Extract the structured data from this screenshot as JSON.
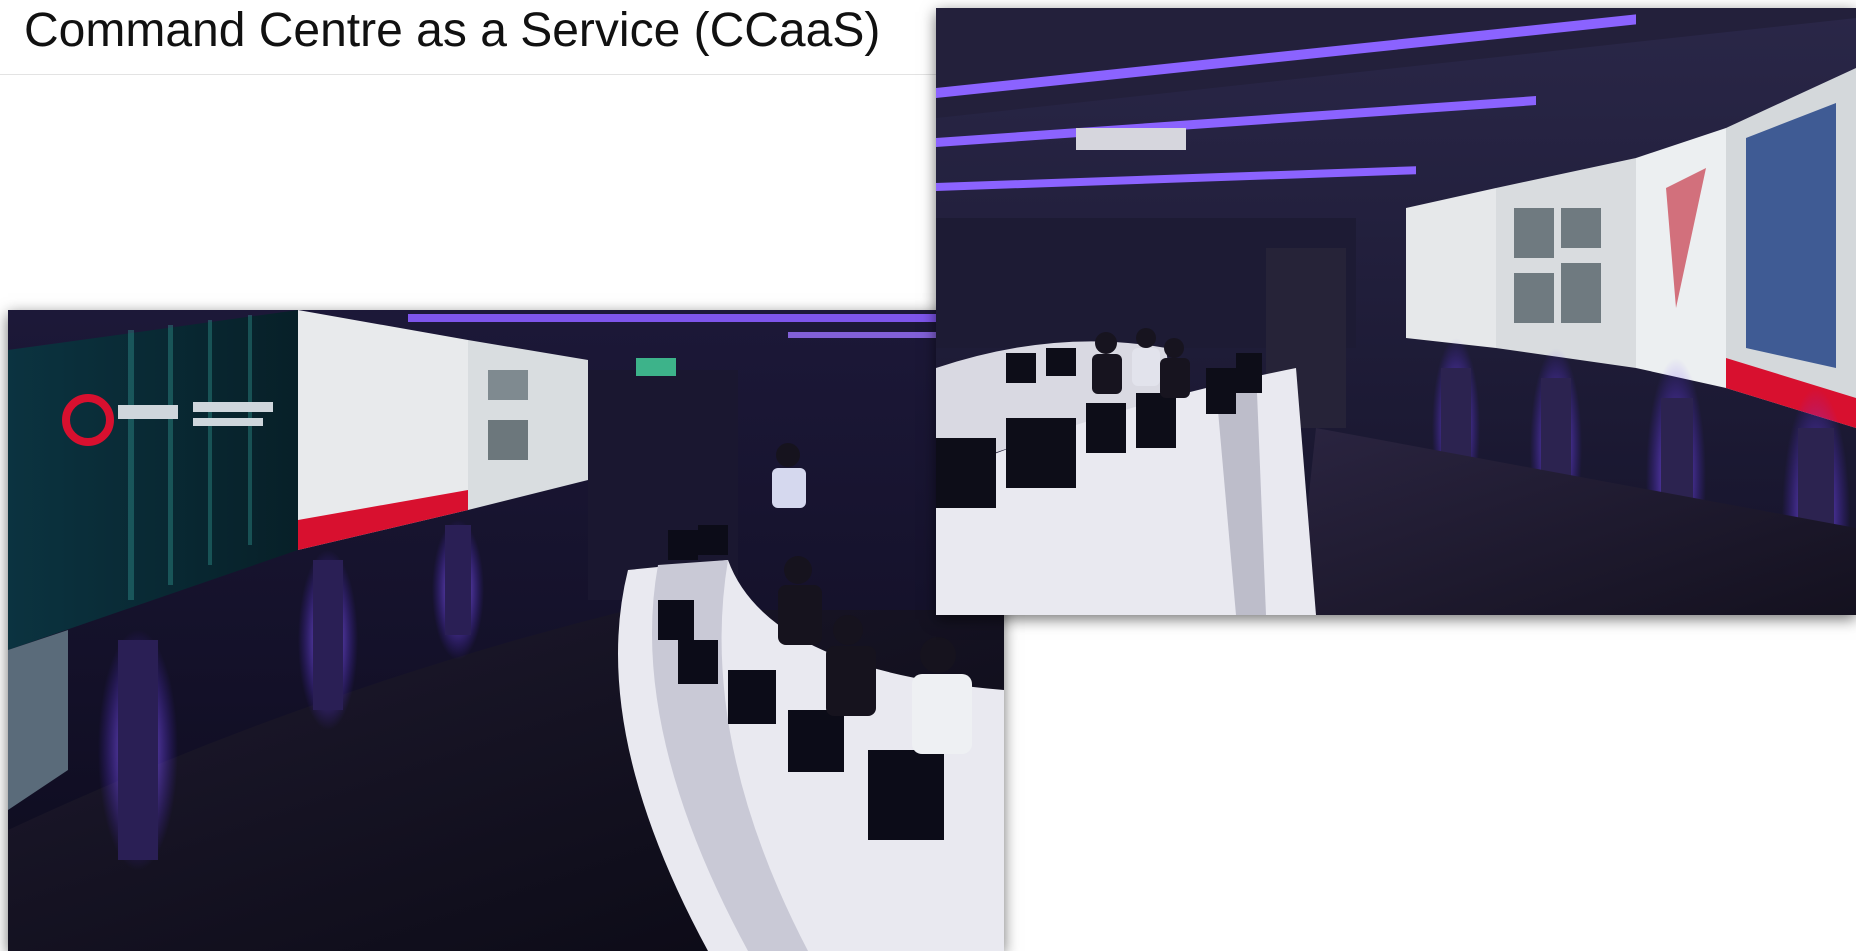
{
  "slide": {
    "title": "Command Centre as a Service (CCaaS)"
  },
  "photos": [
    {
      "name": "control-room-photo-left"
    },
    {
      "name": "control-room-photo-right"
    }
  ],
  "colors": {
    "background": "#ffffff",
    "title_text": "#111111",
    "room_dark": "#14122b",
    "neon_violet": "#7a4dff",
    "console_white": "#e9e9f0",
    "accent_red": "#d8102f"
  }
}
